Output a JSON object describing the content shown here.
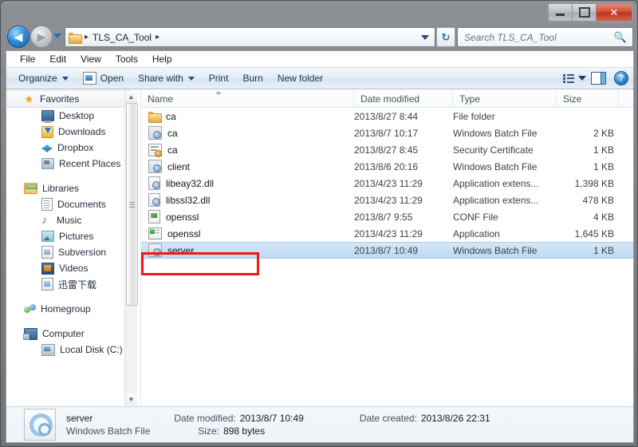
{
  "window": {
    "minimize_label": "Minimize",
    "maximize_label": "Restore",
    "close_label": "✕"
  },
  "nav": {
    "back_label": "◀",
    "forward_label": "▶",
    "history_label": "Recent pages",
    "refresh_label": "↻",
    "breadcrumb": {
      "folder_icon": "folder-icon",
      "sep1": "▸",
      "path": "TLS_CA_Tool",
      "sep2": "▸"
    },
    "search": {
      "placeholder": "Search TLS_CA_Tool",
      "icon": "search-icon"
    }
  },
  "menubar": {
    "items": [
      {
        "label": "File"
      },
      {
        "label": "Edit"
      },
      {
        "label": "View"
      },
      {
        "label": "Tools"
      },
      {
        "label": "Help"
      }
    ]
  },
  "toolbar": {
    "organize_label": "Organize",
    "open_label": "Open",
    "share_label": "Share with",
    "print_label": "Print",
    "burn_label": "Burn",
    "newfolder_label": "New folder",
    "view_icon": "view-options-icon",
    "pane_icon": "preview-pane-icon",
    "help_icon": "help-icon",
    "help_label": "?"
  },
  "sidebar": {
    "groups": [
      {
        "root": {
          "label": "Favorites",
          "icon": "star-icon",
          "selected": true
        },
        "children": [
          {
            "label": "Desktop",
            "icon": "desktop-icon"
          },
          {
            "label": "Downloads",
            "icon": "downloads-icon"
          },
          {
            "label": "Dropbox",
            "icon": "dropbox-icon"
          },
          {
            "label": "Recent Places",
            "icon": "recent-places-icon"
          }
        ]
      },
      {
        "root": {
          "label": "Libraries",
          "icon": "libraries-icon",
          "selected": false
        },
        "children": [
          {
            "label": "Documents",
            "icon": "documents-icon"
          },
          {
            "label": "Music",
            "icon": "music-icon"
          },
          {
            "label": "Pictures",
            "icon": "pictures-icon"
          },
          {
            "label": "Subversion",
            "icon": "subversion-icon"
          },
          {
            "label": "Videos",
            "icon": "videos-icon"
          },
          {
            "label": "迅雷下载",
            "icon": "xunlei-icon"
          }
        ]
      },
      {
        "root": {
          "label": "Homegroup",
          "icon": "homegroup-icon",
          "selected": false
        },
        "children": []
      },
      {
        "root": {
          "label": "Computer",
          "icon": "computer-icon",
          "selected": false
        },
        "children": [
          {
            "label": "Local Disk (C:)",
            "icon": "disk-icon"
          }
        ]
      }
    ],
    "scrollbar": {
      "up": "▲",
      "down": "▼"
    }
  },
  "filelist": {
    "columns": [
      {
        "key": "name",
        "label": "Name",
        "sorted": "asc"
      },
      {
        "key": "date",
        "label": "Date modified"
      },
      {
        "key": "type",
        "label": "Type"
      },
      {
        "key": "size",
        "label": "Size"
      }
    ],
    "rows": [
      {
        "name": "ca",
        "date": "2013/8/27 8:44",
        "type": "File folder",
        "size": "",
        "icon": "folder-icon",
        "selected": false
      },
      {
        "name": "ca",
        "date": "2013/8/7 10:17",
        "type": "Windows Batch File",
        "size": "2 KB",
        "icon": "batch-file-icon",
        "selected": false
      },
      {
        "name": "ca",
        "date": "2013/8/27 8:45",
        "type": "Security Certificate",
        "size": "1 KB",
        "icon": "certificate-icon",
        "selected": false
      },
      {
        "name": "client",
        "date": "2013/8/6 20:16",
        "type": "Windows Batch File",
        "size": "1 KB",
        "icon": "batch-file-icon",
        "selected": false
      },
      {
        "name": "libeay32.dll",
        "date": "2013/4/23 11:29",
        "type": "Application extens...",
        "size": "1,398 KB",
        "icon": "dll-icon",
        "selected": false
      },
      {
        "name": "libssl32.dll",
        "date": "2013/4/23 11:29",
        "type": "Application extens...",
        "size": "478 KB",
        "icon": "dll-icon",
        "selected": false
      },
      {
        "name": "openssl",
        "date": "2013/8/7 9:55",
        "type": "CONF File",
        "size": "4 KB",
        "icon": "conf-file-icon",
        "selected": false
      },
      {
        "name": "openssl",
        "date": "2013/4/23 11:29",
        "type": "Application",
        "size": "1,645 KB",
        "icon": "application-icon",
        "selected": false
      },
      {
        "name": "server",
        "date": "2013/8/7 10:49",
        "type": "Windows Batch File",
        "size": "1 KB",
        "icon": "batch-file-icon",
        "selected": true
      }
    ]
  },
  "details": {
    "icon": "batch-file-large-icon",
    "title": "server",
    "subtitle": "Windows Batch File",
    "date_modified_label": "Date modified:",
    "date_modified_value": "2013/8/7 10:49",
    "size_label": "Size:",
    "size_value": "898 bytes",
    "date_created_label": "Date created:",
    "date_created_value": "2013/8/26 22:31"
  },
  "annotation": {
    "color": "#ee1b10",
    "target": "server"
  }
}
